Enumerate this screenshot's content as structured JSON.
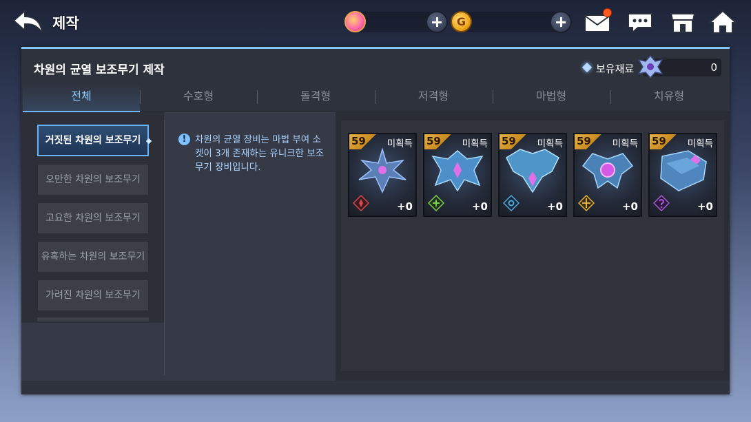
{
  "header": {
    "title": "제작"
  },
  "panel": {
    "title": "차원의 균열 보조무기 제작",
    "owned_label": "보유재료",
    "owned_value": "0"
  },
  "tabs": [
    {
      "label": "전체",
      "active": true
    },
    {
      "label": "수호형",
      "active": false
    },
    {
      "label": "돌격형",
      "active": false
    },
    {
      "label": "저격형",
      "active": false
    },
    {
      "label": "마법형",
      "active": false
    },
    {
      "label": "치유형",
      "active": false
    }
  ],
  "sidebar": {
    "items": [
      {
        "label": "거짓된 차원의 보조무기",
        "active": true
      },
      {
        "label": "오만한 차원의 보조무기",
        "active": false
      },
      {
        "label": "고요한 차원의 보조무기",
        "active": false
      },
      {
        "label": "유혹하는 차원의 보조무기",
        "active": false
      },
      {
        "label": "가려진 차원의 보조무기",
        "active": false
      }
    ]
  },
  "info": {
    "text": "차원의 균열 장비는 마법 부여 소켓이 3개 존재하는 유니크한 보조 무기 장비입니다."
  },
  "items": [
    {
      "level": "59",
      "status": "미획득",
      "enhance": "+0",
      "class_icon": "guardian-icon",
      "class_color": "#d8474a"
    },
    {
      "level": "59",
      "status": "미획득",
      "enhance": "+0",
      "class_icon": "assault-icon",
      "class_color": "#7fcf55"
    },
    {
      "level": "59",
      "status": "미획득",
      "enhance": "+0",
      "class_icon": "sniper-icon",
      "class_color": "#4fa9e0"
    },
    {
      "level": "59",
      "status": "미획득",
      "enhance": "+0",
      "class_icon": "magic-icon",
      "class_color": "#e0b040"
    },
    {
      "level": "59",
      "status": "미획득",
      "enhance": "+0",
      "class_icon": "healer-icon",
      "class_color": "#a55ad8"
    }
  ]
}
